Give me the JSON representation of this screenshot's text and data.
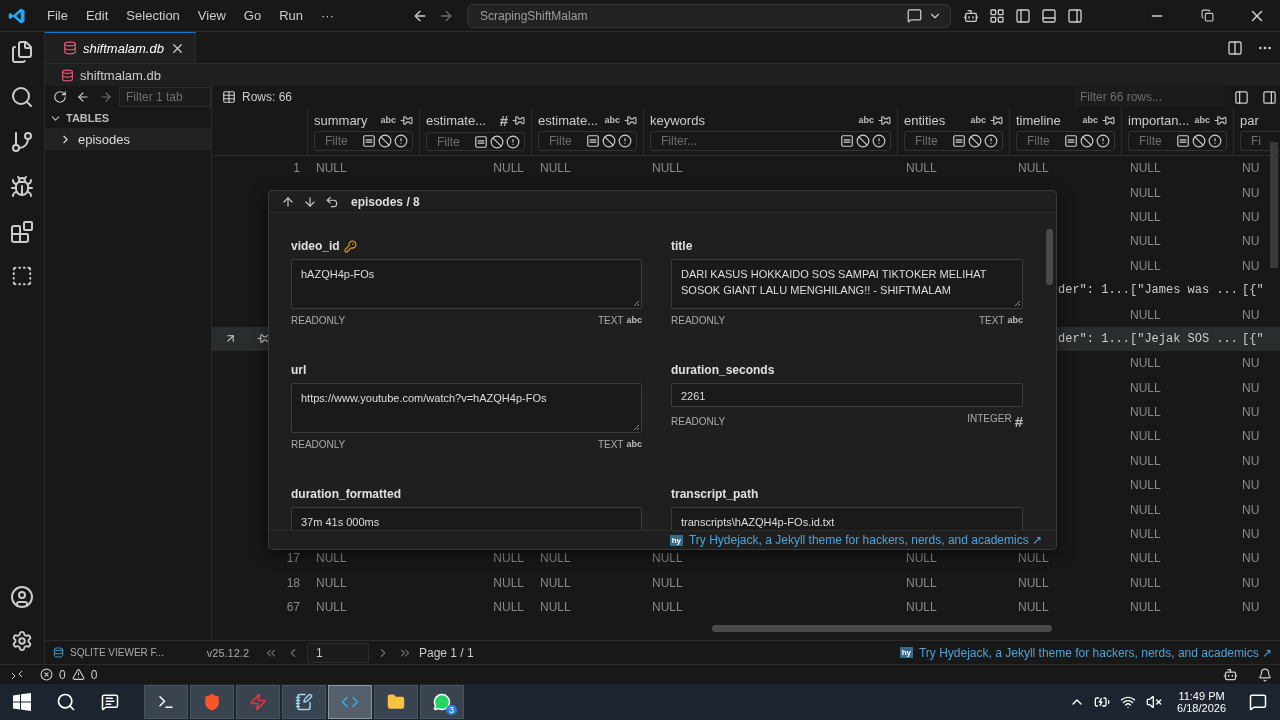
{
  "menu": [
    "File",
    "Edit",
    "Selection",
    "View",
    "Go",
    "Run",
    "···"
  ],
  "command_center": {
    "text": "ScrapingShiftMalam"
  },
  "editor_tab": {
    "label": "shiftmalam.db",
    "selected": true
  },
  "breadcrumb": "shiftmalam.db",
  "sidebar": {
    "filter_placeholder": "Filter 1 tab",
    "section": "TABLES",
    "items": [
      {
        "label": "episodes",
        "expanded": false
      }
    ]
  },
  "toolbar": {
    "rows": "Rows: 66",
    "filter_placeholder": "Filter 66 rows..."
  },
  "grid": {
    "columns": [
      {
        "name": "summary",
        "numeric": false,
        "glyph": "abc",
        "filter_placeholder": "Filte"
      },
      {
        "name": "estimate...",
        "numeric": true,
        "glyph": "#",
        "filter_placeholder": "Filte"
      },
      {
        "name": "estimate...",
        "numeric": false,
        "glyph": "abc",
        "filter_placeholder": "Filte"
      },
      {
        "name": "keywords",
        "numeric": false,
        "glyph": "abc",
        "filter_placeholder": "Filter..."
      },
      {
        "name": "entities",
        "numeric": false,
        "glyph": "abc",
        "filter_placeholder": "Filte"
      },
      {
        "name": "timeline",
        "numeric": false,
        "glyph": "abc",
        "filter_placeholder": "Filte"
      },
      {
        "name": "importan...",
        "numeric": false,
        "glyph": "abc",
        "filter_placeholder": "Filte"
      },
      {
        "name": "par",
        "filter_placeholder": "Fi"
      }
    ],
    "rows": [
      {
        "number": "1",
        "selected": false,
        "cells": [
          "NULL",
          "NULL",
          "NULL",
          "NULL",
          "NULL",
          "NULL",
          "NULL",
          "NU"
        ]
      },
      {
        "selected": false,
        "cells": [
          null,
          null,
          null,
          null,
          null,
          null,
          "NULL",
          "NU"
        ]
      },
      {
        "selected": false,
        "cells": [
          null,
          null,
          null,
          null,
          null,
          null,
          "NULL",
          "NU"
        ]
      },
      {
        "selected": false,
        "cells": [
          null,
          null,
          null,
          null,
          null,
          null,
          "NULL",
          "NU"
        ]
      },
      {
        "selected": false,
        "cells": [
          null,
          null,
          null,
          null,
          null,
          null,
          "NULL",
          "NU"
        ]
      },
      {
        "selected": false,
        "cells": [
          null,
          null,
          null,
          null,
          null,
          {
            "text": "der\": 1...",
            "clipped": true
          },
          "[\"James was ...",
          "[{\""
        ]
      },
      {
        "selected": false,
        "cells": [
          null,
          null,
          null,
          null,
          null,
          null,
          "NULL",
          "NU"
        ]
      },
      {
        "selected": true,
        "cells": [
          null,
          null,
          null,
          null,
          null,
          {
            "text": "der\": 1...",
            "clipped": true
          },
          "[\"Jejak SOS ...",
          "[{\""
        ]
      },
      {
        "selected": false,
        "cells": [
          null,
          null,
          null,
          null,
          null,
          null,
          "NULL",
          "NU"
        ]
      },
      {
        "selected": false,
        "cells": [
          null,
          null,
          null,
          null,
          null,
          null,
          "NULL",
          "NU"
        ]
      },
      {
        "selected": false,
        "cells": [
          null,
          null,
          null,
          null,
          null,
          null,
          "NULL",
          "NU"
        ]
      },
      {
        "selected": false,
        "cells": [
          null,
          null,
          null,
          null,
          null,
          null,
          "NULL",
          "NU"
        ]
      },
      {
        "selected": false,
        "cells": [
          null,
          null,
          null,
          null,
          null,
          null,
          "NULL",
          "NU"
        ]
      },
      {
        "selected": false,
        "cells": [
          null,
          null,
          null,
          null,
          null,
          null,
          "NULL",
          "NU"
        ]
      },
      {
        "selected": false,
        "cells": [
          null,
          null,
          null,
          null,
          null,
          null,
          "NULL",
          "NU"
        ]
      },
      {
        "selected": false,
        "cells": [
          null,
          null,
          null,
          null,
          null,
          null,
          "NULL",
          "NU"
        ]
      },
      {
        "number": "17",
        "selected": false,
        "cells": [
          "NULL",
          "NULL",
          "NULL",
          "NULL",
          "NULL",
          "NULL",
          "NULL",
          "NU"
        ]
      },
      {
        "number": "18",
        "selected": false,
        "cells": [
          "NULL",
          "NULL",
          "NULL",
          "NULL",
          "NULL",
          "NULL",
          "NULL",
          "NU"
        ]
      },
      {
        "number": "67",
        "selected": false,
        "cells": [
          "NULL",
          "NULL",
          "NULL",
          "NULL",
          "NULL",
          "NULL",
          "NULL",
          "NU"
        ]
      }
    ]
  },
  "record": {
    "table": "episodes",
    "separator": "/",
    "row": "8",
    "fields": [
      {
        "label": "video_id",
        "primary_key": true,
        "value": "hAZQH4p-FOs",
        "multiline": true,
        "note": "READONLY",
        "type_label": "TEXT",
        "glyph": "abc"
      },
      {
        "label": "title",
        "value": "DARI KASUS HOKKAIDO SOS SAMPAI TIKTOKER MELIHAT SOSOK GIANT LALU MENGHILANG!! - SHIFTMALAM",
        "multiline": true,
        "note": "READONLY",
        "type_label": "TEXT",
        "glyph": "abc"
      },
      {
        "label": "url",
        "value": "https://www.youtube.com/watch?v=hAZQH4p-FOs",
        "multiline": true,
        "note": "READONLY",
        "type_label": "TEXT",
        "glyph": "abc"
      },
      {
        "label": "duration_seconds",
        "value": "2261",
        "multiline": false,
        "note": "READONLY",
        "type_label": "INTEGER",
        "glyph": "#"
      },
      {
        "label": "duration_formatted",
        "value": "37m 41s 000ms",
        "multiline": true
      },
      {
        "label": "transcript_path",
        "value": "transcripts\\hAZQH4p-FOs.id.txt",
        "multiline": true
      }
    ],
    "promo": {
      "badge": "hy",
      "text": "Try Hydejack, a Jekyll theme for hackers, nerds, and academics ↗"
    }
  },
  "footer": {
    "extension": "SQLITE VIEWER F...",
    "version": "v25.12.2",
    "page_input": "1",
    "page": "Page 1 / 1",
    "promo_badge": "hy",
    "promo": "Try Hydejack, a Jekyll theme for hackers, nerds, and academics ↗"
  },
  "status_bar": {
    "errors": "0",
    "warnings": "0"
  },
  "taskbar": {
    "apps": [
      {
        "kind": "terminal",
        "active": false
      },
      {
        "kind": "browser",
        "active": false
      },
      {
        "kind": "app",
        "active": false
      },
      {
        "kind": "notes",
        "active": false
      },
      {
        "kind": "code",
        "active": true
      },
      {
        "kind": "files",
        "active": false
      },
      {
        "kind": "chat",
        "active": false,
        "badge": "3"
      }
    ],
    "time": "11:49 PM",
    "date": "6/18/2026"
  }
}
